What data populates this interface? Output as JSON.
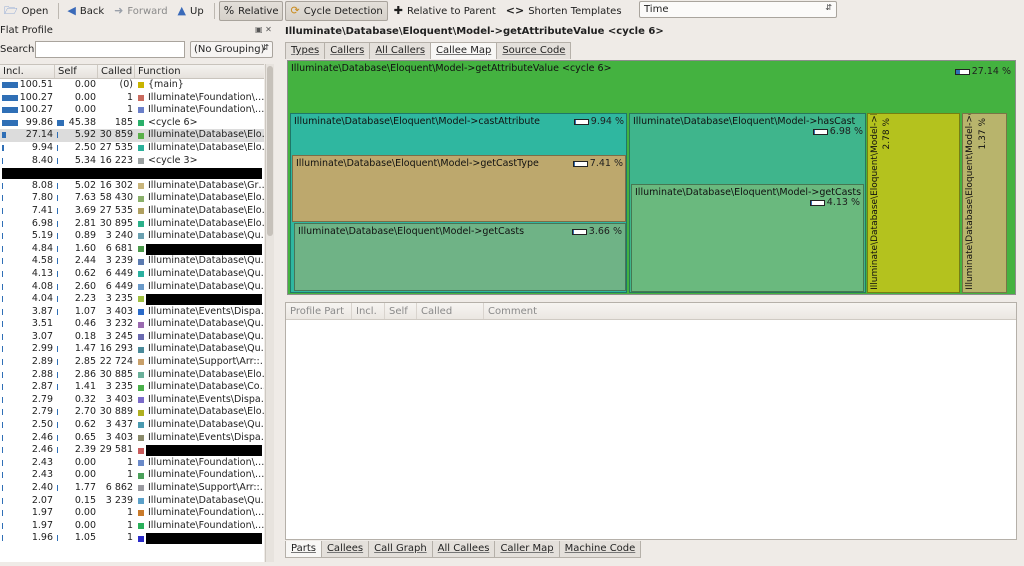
{
  "toolbar": {
    "open": "Open",
    "back": "Back",
    "forward": "Forward",
    "up": "Up",
    "relative": "Relative",
    "cycle_detection": "Cycle Detection",
    "relative_to_parent": "Relative to Parent",
    "shorten_templates": "Shorten Templates",
    "event_type": "Time",
    "icons": {
      "open": "folder-icon",
      "back": "arrow-left-icon",
      "forward": "arrow-right-icon",
      "up": "arrow-up-icon",
      "relative": "percent-icon",
      "cycle": "cycle-icon",
      "parent": "move-icon",
      "templates": "angle-brackets-icon"
    }
  },
  "flat_profile": {
    "title": "Flat Profile",
    "search_label": "Search:",
    "search_value": "",
    "grouping": "(No Grouping)",
    "columns": [
      "Incl.",
      "Self",
      "Called",
      "Function"
    ],
    "rows": [
      {
        "incl": "100.51",
        "self": "0.00",
        "called": "(0)",
        "func": "{main}",
        "ib": 1.0,
        "sb": 0,
        "color": "#c8b400",
        "r": false
      },
      {
        "incl": "100.27",
        "self": "0.00",
        "called": "1",
        "func": "Illuminate\\Foundation\\…",
        "ib": 1.0,
        "sb": 0,
        "color": "#c96a5e",
        "r": false
      },
      {
        "incl": "100.27",
        "self": "0.00",
        "called": "1",
        "func": "Illuminate\\Foundation\\…",
        "ib": 1.0,
        "sb": 0,
        "color": "#6a7fc9",
        "r": false
      },
      {
        "incl": "99.86",
        "self": "45.38",
        "called": "185",
        "func": "<cycle 6>",
        "ib": 0.99,
        "sb": 0.45,
        "color": "#2ab06a",
        "r": false
      },
      {
        "incl": "27.14",
        "self": "5.92",
        "called": "30 859",
        "func": "Illuminate\\Database\\Elo…",
        "ib": 0.27,
        "sb": 0.06,
        "color": "#59b04a",
        "r": false,
        "sel": true
      },
      {
        "incl": "9.94",
        "self": "2.50",
        "called": "27 535",
        "func": "Illuminate\\Database\\Elo…",
        "ib": 0.1,
        "sb": 0.02,
        "color": "#2ab09a",
        "r": false
      },
      {
        "incl": "8.40",
        "self": "5.34",
        "called": "16 223",
        "func": "<cycle 3>",
        "ib": 0.08,
        "sb": 0.05,
        "color": "#9aa0a0",
        "r": false
      },
      {
        "incl": "",
        "self": "",
        "called": "",
        "func": "",
        "ib": 0.05,
        "sb": 0,
        "color": "",
        "r": true
      },
      {
        "incl": "8.08",
        "self": "5.02",
        "called": "16 302",
        "func": "Illuminate\\Database\\Gr…",
        "ib": 0.08,
        "sb": 0.05,
        "color": "#c8b47a",
        "r": false
      },
      {
        "incl": "7.80",
        "self": "7.63",
        "called": "58 430",
        "func": "Illuminate\\Database\\Elo…",
        "ib": 0.08,
        "sb": 0.07,
        "color": "#8ab06a",
        "r": false
      },
      {
        "incl": "7.41",
        "self": "3.69",
        "called": "27 535",
        "func": "Illuminate\\Database\\Elo…",
        "ib": 0.07,
        "sb": 0.03,
        "color": "#b0a060",
        "r": false
      },
      {
        "incl": "6.98",
        "self": "2.81",
        "called": "30 895",
        "func": "Illuminate\\Database\\Elo…",
        "ib": 0.07,
        "sb": 0.03,
        "color": "#2ab08a",
        "r": false
      },
      {
        "incl": "5.19",
        "self": "0.89",
        "called": "3 240",
        "func": "Illuminate\\Database\\Qu…",
        "ib": 0.05,
        "sb": 0.01,
        "color": "#6aa0b0",
        "r": false
      },
      {
        "incl": "4.84",
        "self": "1.60",
        "called": "6 681",
        "func": "",
        "ib": 0.05,
        "sb": 0.01,
        "color": "#4a9a4a",
        "r": true
      },
      {
        "incl": "4.58",
        "self": "2.44",
        "called": "3 239",
        "func": "Illuminate\\Database\\Qu…",
        "ib": 0.04,
        "sb": 0.02,
        "color": "#5a7ab0",
        "r": false
      },
      {
        "incl": "4.13",
        "self": "0.62",
        "called": "6 449",
        "func": "Illuminate\\Database\\Qu…",
        "ib": 0.04,
        "sb": 0.01,
        "color": "#2ab0a0",
        "r": false
      },
      {
        "incl": "4.08",
        "self": "2.60",
        "called": "6 449",
        "func": "Illuminate\\Database\\Qu…",
        "ib": 0.04,
        "sb": 0.02,
        "color": "#6a9ac9",
        "r": false
      },
      {
        "incl": "4.04",
        "self": "2.23",
        "called": "3 235",
        "func": "",
        "ib": 0.04,
        "sb": 0.02,
        "color": "#a0c040",
        "r": true
      },
      {
        "incl": "3.87",
        "self": "1.07",
        "called": "3 403",
        "func": "Illuminate\\Events\\Dispa…",
        "ib": 0.04,
        "sb": 0.01,
        "color": "#2a6ac9",
        "r": false
      },
      {
        "incl": "3.51",
        "self": "0.46",
        "called": "3 232",
        "func": "Illuminate\\Database\\Qu…",
        "ib": 0.03,
        "sb": 0,
        "color": "#9a6ab0",
        "r": false
      },
      {
        "incl": "3.07",
        "self": "0.18",
        "called": "3 245",
        "func": "Illuminate\\Database\\Qu…",
        "ib": 0.03,
        "sb": 0,
        "color": "#6a6ab0",
        "r": false
      },
      {
        "incl": "2.99",
        "self": "1.47",
        "called": "16 293",
        "func": "Illuminate\\Database\\Qu…",
        "ib": 0.03,
        "sb": 0.01,
        "color": "#4a8a9a",
        "r": false
      },
      {
        "incl": "2.89",
        "self": "2.85",
        "called": "22 724",
        "func": "Illuminate\\Support\\Arr::…",
        "ib": 0.03,
        "sb": 0.03,
        "color": "#c9a06a",
        "r": false
      },
      {
        "incl": "2.88",
        "self": "2.86",
        "called": "30 885",
        "func": "Illuminate\\Database\\Elo…",
        "ib": 0.03,
        "sb": 0.03,
        "color": "#6ab09a",
        "r": false
      },
      {
        "incl": "2.87",
        "self": "1.41",
        "called": "3 235",
        "func": "Illuminate\\Database\\Co…",
        "ib": 0.03,
        "sb": 0.01,
        "color": "#4ab04a",
        "r": false
      },
      {
        "incl": "2.79",
        "self": "0.32",
        "called": "3 403",
        "func": "Illuminate\\Events\\Dispa…",
        "ib": 0.03,
        "sb": 0,
        "color": "#7a6ac9",
        "r": false
      },
      {
        "incl": "2.79",
        "self": "2.70",
        "called": "30 889",
        "func": "Illuminate\\Database\\Elo…",
        "ib": 0.03,
        "sb": 0.03,
        "color": "#b0b020",
        "r": false
      },
      {
        "incl": "2.50",
        "self": "0.62",
        "called": "3 437",
        "func": "Illuminate\\Database\\Qu…",
        "ib": 0.02,
        "sb": 0.01,
        "color": "#4a9ab0",
        "r": false
      },
      {
        "incl": "2.46",
        "self": "0.65",
        "called": "3 403",
        "func": "Illuminate\\Events\\Dispa…",
        "ib": 0.02,
        "sb": 0.01,
        "color": "#8a8a6a",
        "r": false
      },
      {
        "incl": "2.46",
        "self": "2.39",
        "called": "29 581",
        "func": "",
        "ib": 0.02,
        "sb": 0.02,
        "color": "#c95a5a",
        "r": true
      },
      {
        "incl": "2.43",
        "self": "0.00",
        "called": "1",
        "func": "Illuminate\\Foundation\\…",
        "ib": 0.02,
        "sb": 0,
        "color": "#6a8ac9",
        "r": false
      },
      {
        "incl": "2.43",
        "self": "0.00",
        "called": "1",
        "func": "Illuminate\\Foundation\\…",
        "ib": 0.02,
        "sb": 0,
        "color": "#4aa05a",
        "r": false
      },
      {
        "incl": "2.40",
        "self": "1.77",
        "called": "6 862",
        "func": "Illuminate\\Support\\Arr::…",
        "ib": 0.02,
        "sb": 0.02,
        "color": "#9a9aa0",
        "r": false
      },
      {
        "incl": "2.07",
        "self": "0.15",
        "called": "3 239",
        "func": "Illuminate\\Database\\Qu…",
        "ib": 0.02,
        "sb": 0,
        "color": "#5aa0c9",
        "r": false
      },
      {
        "incl": "1.97",
        "self": "0.00",
        "called": "1",
        "func": "Illuminate\\Foundation\\…",
        "ib": 0.02,
        "sb": 0,
        "color": "#c97a2a",
        "r": false
      },
      {
        "incl": "1.97",
        "self": "0.00",
        "called": "1",
        "func": "Illuminate\\Foundation\\…",
        "ib": 0.02,
        "sb": 0,
        "color": "#2ab05a",
        "r": false
      },
      {
        "incl": "1.96",
        "self": "1.05",
        "called": "1",
        "func": "",
        "ib": 0.02,
        "sb": 0.01,
        "color": "#2a2ac9",
        "r": true
      }
    ]
  },
  "detail": {
    "title": "Illuminate\\Database\\Eloquent\\Model->getAttributeValue <cycle 6>",
    "tabs": [
      "Types",
      "Callers",
      "All Callers",
      "Callee Map",
      "Source Code"
    ],
    "active_tab": 3,
    "map": {
      "root": {
        "label": "Illuminate\\Database\\Eloquent\\Model->getAttributeValue <cycle 6>",
        "pct": "27.14 %",
        "fill": 0.27
      },
      "cast_attribute": {
        "label": "Illuminate\\Database\\Eloquent\\Model->castAttribute",
        "pct": "9.94 %",
        "fill": 0.1
      },
      "get_cast_type": {
        "label": "Illuminate\\Database\\Eloquent\\Model->getCastType",
        "pct": "7.41 %",
        "fill": 0.07
      },
      "get_casts_1": {
        "label": "Illuminate\\Database\\Eloquent\\Model->getCasts",
        "pct": "3.66 %",
        "fill": 0.04
      },
      "has_cast": {
        "label": "Illuminate\\Database\\Eloquent\\Model->hasCast",
        "pct": "6.98 %",
        "fill": 0.07
      },
      "get_casts_2": {
        "label": "Illuminate\\Database\\Eloquent\\Model->getCasts",
        "pct": "4.13 %",
        "fill": 0.04
      },
      "has_get_mutator": {
        "label": "Illuminate\\Database\\Eloquent\\Model->hasGetMutator",
        "pct": "2.78 %",
        "fill": 0.03
      },
      "get_attribute_from_array": {
        "label": "Illuminate\\Database\\Eloquent\\Model->getAttributeFromArray",
        "pct": "1.37 %",
        "fill": 0.01
      }
    },
    "lower_columns": [
      "Profile Part",
      "Incl.",
      "Self",
      "Called",
      "Comment"
    ],
    "bottom_tabs": [
      "Parts",
      "Callees",
      "Call Graph",
      "All Callees",
      "Caller Map",
      "Machine Code"
    ],
    "active_bottom_tab": 0
  }
}
